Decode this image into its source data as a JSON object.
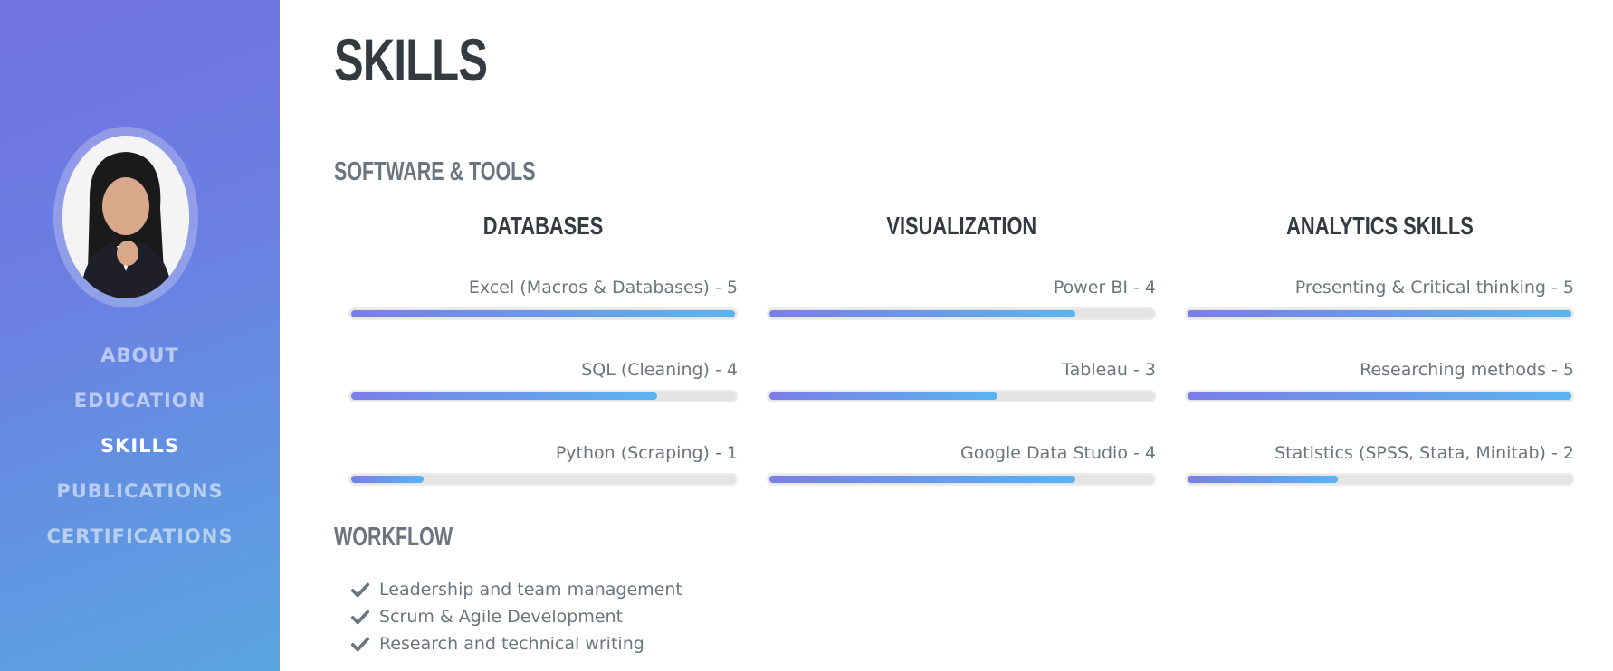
{
  "sidebar": {
    "nav": [
      {
        "label": "ABOUT",
        "active": false
      },
      {
        "label": "EDUCATION",
        "active": false
      },
      {
        "label": "SKILLS",
        "active": true
      },
      {
        "label": "PUBLICATIONS",
        "active": false
      },
      {
        "label": "CERTIFICATIONS",
        "active": false
      }
    ]
  },
  "main": {
    "title": "SKILLS",
    "software_tools": {
      "heading": "SOFTWARE & TOOLS",
      "columns": [
        {
          "title": "DATABASES",
          "skills": [
            {
              "label": "Excel (Macros & Databases) - 5",
              "level": 5
            },
            {
              "label": "SQL (Cleaning) - 4",
              "level": 4
            },
            {
              "label": "Python (Scraping) - 1",
              "level": 1
            }
          ]
        },
        {
          "title": "VISUALIZATION",
          "skills": [
            {
              "label": "Power BI - 4",
              "level": 4
            },
            {
              "label": "Tableau - 3",
              "level": 3
            },
            {
              "label": "Google Data Studio - 4",
              "level": 4
            }
          ]
        },
        {
          "title": "ANALYTICS SKILLS",
          "skills": [
            {
              "label": "Presenting & Critical thinking - 5",
              "level": 5
            },
            {
              "label": "Researching methods - 5",
              "level": 5
            },
            {
              "label": "Statistics (SPSS, Stata, Minitab) - 2",
              "level": 2
            }
          ]
        }
      ]
    },
    "workflow": {
      "heading": "WORKFLOW",
      "items": [
        "Leadership and team management",
        "Scrum & Agile Development",
        "Research and technical writing"
      ]
    }
  },
  "colors": {
    "sidebar_start": "#7173e0",
    "sidebar_end": "#5aa6e0",
    "bar_start": "#7b7ee8",
    "bar_end": "#5ab4f0",
    "text_dark": "#343a40",
    "text_muted": "#6c757d"
  },
  "icons": {
    "workflow_bullet": "check-icon",
    "profile": "avatar"
  }
}
